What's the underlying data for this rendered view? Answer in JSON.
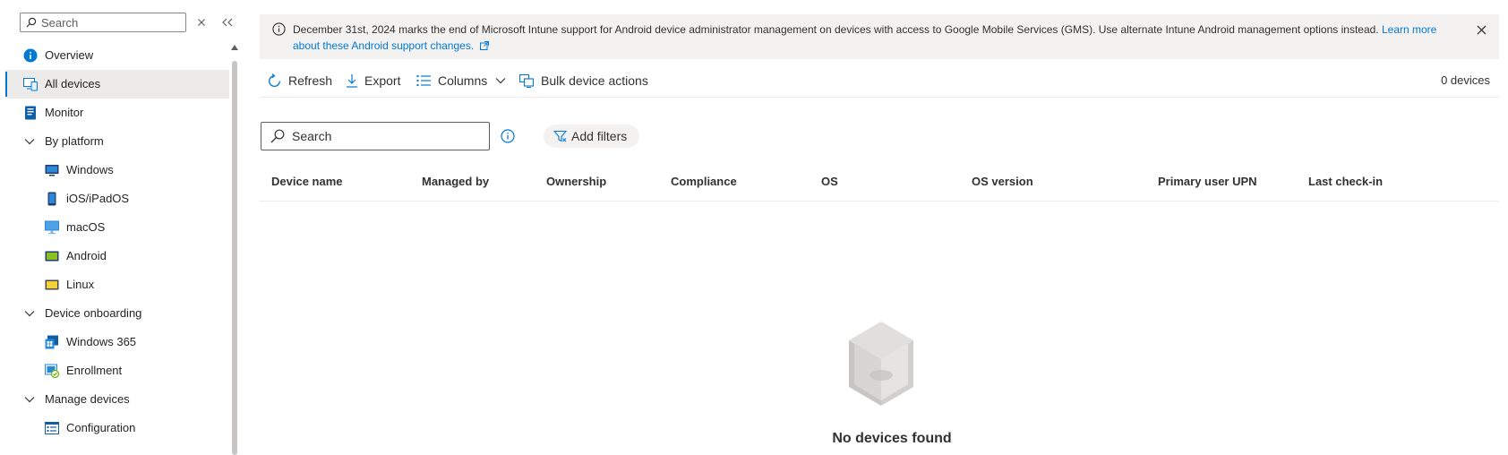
{
  "sidebar": {
    "search_placeholder": "Search",
    "items": [
      {
        "label": "Overview",
        "icon": "info-icon"
      },
      {
        "label": "All devices",
        "icon": "all-devices-icon",
        "selected": true
      },
      {
        "label": "Monitor",
        "icon": "monitor-icon"
      },
      {
        "label": "By platform",
        "icon": "chevron-down-icon",
        "group": true
      },
      {
        "label": "Windows",
        "icon": "windows-device-icon"
      },
      {
        "label": "iOS/iPadOS",
        "icon": "phone-icon"
      },
      {
        "label": "macOS",
        "icon": "mac-icon"
      },
      {
        "label": "Android",
        "icon": "android-icon"
      },
      {
        "label": "Linux",
        "icon": "linux-icon"
      },
      {
        "label": "Device onboarding",
        "icon": "chevron-down-icon",
        "group": true
      },
      {
        "label": "Windows 365",
        "icon": "windows-365-icon"
      },
      {
        "label": "Enrollment",
        "icon": "enrollment-icon"
      },
      {
        "label": "Manage devices",
        "icon": "chevron-down-icon",
        "group": true
      },
      {
        "label": "Configuration",
        "icon": "configuration-icon"
      }
    ]
  },
  "banner": {
    "message": "December 31st, 2024 marks the end of Microsoft Intune support for Android device administrator management on devices with access to Google Mobile Services (GMS). Use alternate Intune Android management options instead.",
    "link": "Learn more about these Android support changes."
  },
  "toolbar": {
    "refresh": "Refresh",
    "export": "Export",
    "columns": "Columns",
    "bulk": "Bulk device actions",
    "device_count": "0 devices"
  },
  "filter": {
    "search_placeholder": "Search",
    "add_filters": "Add filters"
  },
  "table": {
    "columns": [
      "Device name",
      "Managed by",
      "Ownership",
      "Compliance",
      "OS",
      "OS version",
      "Primary user UPN",
      "Last check-in"
    ]
  },
  "empty_state": {
    "message": "No devices found"
  },
  "colors": {
    "accent": "#0078d4",
    "banner_bg": "#f3f2f1",
    "selected_bg": "#edebe9"
  }
}
